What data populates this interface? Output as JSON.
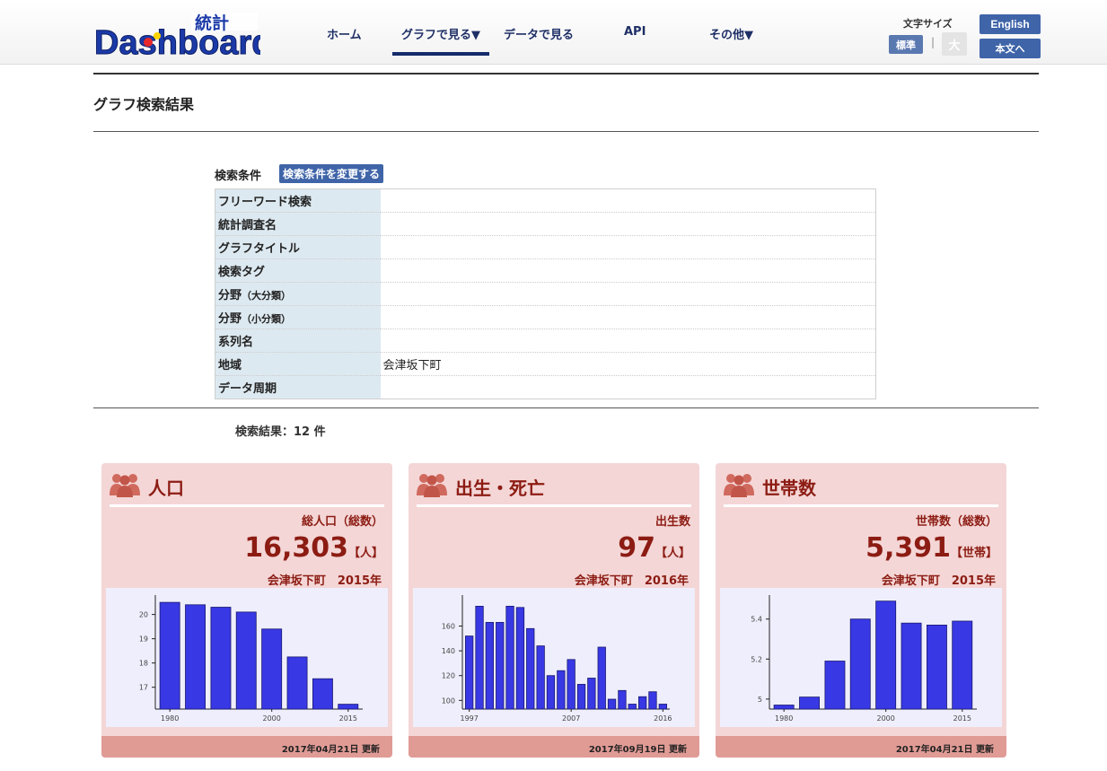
{
  "header": {
    "logo_main": "Dashboard",
    "logo_kanji": "統計",
    "nav": [
      {
        "label": "ホーム"
      },
      {
        "label": "グラフで見る▼"
      },
      {
        "label": "データで見る"
      },
      {
        "label": "API"
      },
      {
        "label": "その他▼"
      }
    ],
    "font_size_label": "文字サイズ",
    "font_size_standard": "標準",
    "font_size_separator": "|",
    "font_size_large": "大",
    "english_label": "English",
    "honbun_label": "本文へ"
  },
  "page": {
    "title": "グラフ検索結果",
    "search_conditions_label": "検索条件",
    "change_conditions_label": "検索条件を変更する",
    "result_count": "検索結果：12 件"
  },
  "conditions": [
    {
      "key": "フリーワード検索",
      "key_sub": "",
      "value": ""
    },
    {
      "key": "統計調査名",
      "key_sub": "",
      "value": ""
    },
    {
      "key": "グラフタイトル",
      "key_sub": "",
      "value": ""
    },
    {
      "key": "検索タグ",
      "key_sub": "",
      "value": ""
    },
    {
      "key": "分野",
      "key_sub": "（大分類）",
      "value": ""
    },
    {
      "key": "分野",
      "key_sub": "（小分類）",
      "value": ""
    },
    {
      "key": "系列名",
      "key_sub": "",
      "value": ""
    },
    {
      "key": "地域",
      "key_sub": "",
      "value": "会津坂下町"
    },
    {
      "key": "データ周期",
      "key_sub": "",
      "value": ""
    }
  ],
  "cards": [
    {
      "title": "人口",
      "metric": "総人口（総数）",
      "value": "16,303",
      "unit": "【人】",
      "region_year": "会津坂下町　2015年",
      "updated": "2017年04月21日 更新"
    },
    {
      "title": "出生・死亡",
      "metric": "出生数",
      "value": "97",
      "unit": "【人】",
      "region_year": "会津坂下町　2016年",
      "updated": "2017年09月19日 更新"
    },
    {
      "title": "世帯数",
      "metric": "世帯数（総数）",
      "value": "5,391",
      "unit": "【世帯】",
      "region_year": "会津坂下町　2015年",
      "updated": "2017年04月21日 更新"
    }
  ],
  "colors": {
    "bar": "#3838e4",
    "card_bg": "#f4d6d6",
    "card_footer": "#e09b95",
    "accent_text": "#8c1c13",
    "nav_text": "#1e2f66",
    "button_blue": "#3f64a8"
  },
  "chart_data": [
    {
      "type": "bar",
      "categories": [
        "1980",
        "1985",
        "1990",
        "1995",
        "2000",
        "2005",
        "2010",
        "2015"
      ],
      "values": [
        20.5,
        20.4,
        20.3,
        20.1,
        19.4,
        18.25,
        17.35,
        16.3
      ],
      "ylim": [
        16.1,
        20.8
      ],
      "yticks": [
        17,
        18,
        19,
        20
      ],
      "ytick_labels": [
        "17",
        "18",
        "19",
        "20"
      ],
      "xticks": [
        "1980",
        "2000",
        "2015"
      ]
    },
    {
      "type": "bar",
      "categories": [
        "1997",
        "1998",
        "1999",
        "2000",
        "2001",
        "2002",
        "2003",
        "2004",
        "2005",
        "2006",
        "2007",
        "2008",
        "2009",
        "2010",
        "2011",
        "2012",
        "2013",
        "2014",
        "2015",
        "2016"
      ],
      "values": [
        152,
        176,
        163,
        163,
        176,
        175,
        158,
        144,
        120,
        124,
        133,
        113,
        118,
        143,
        101,
        108,
        97,
        103,
        107,
        97
      ],
      "ylim": [
        93,
        185
      ],
      "yticks": [
        100,
        120,
        140,
        160
      ],
      "ytick_labels": [
        "100",
        "120",
        "140",
        "160"
      ],
      "xticks": [
        "1997",
        "2007",
        "2016"
      ]
    },
    {
      "type": "bar",
      "categories": [
        "1980",
        "1985",
        "1990",
        "1995",
        "2000",
        "2005",
        "2010",
        "2015"
      ],
      "values": [
        4.97,
        5.01,
        5.19,
        5.4,
        5.49,
        5.38,
        5.37,
        5.39
      ],
      "ylim": [
        4.95,
        5.52
      ],
      "yticks": [
        5.0,
        5.2,
        5.4
      ],
      "ytick_labels": [
        "5",
        "5.2",
        "5.4"
      ],
      "xticks": [
        "1980",
        "2000",
        "2015"
      ]
    }
  ]
}
